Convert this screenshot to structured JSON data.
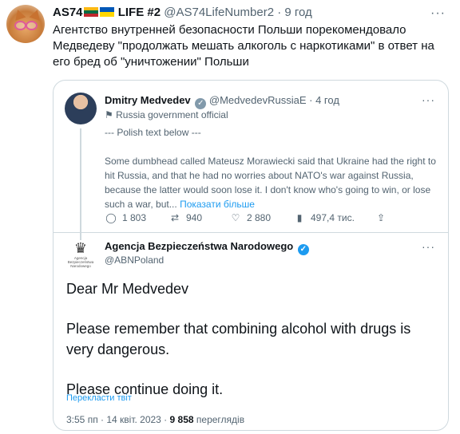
{
  "outer_tweet": {
    "author_name": "AS74",
    "author_suffix": "LIFE #2",
    "handle": "@AS74LifeNumber2",
    "separator": "·",
    "time": "9 год",
    "text": "Агентство внутренней безопасности Польши порекомендовало Медведеву \"продолжать мешать алкоголь с наркотиками\" в ответ на его бред об \"уничтожении\" Польши",
    "more_icon": "more-horizontal-icon"
  },
  "quoted_tweet": {
    "author_name": "Dmitry Medvedev",
    "handle": "@MedvedevRussiaE",
    "separator": "·",
    "time": "4 год",
    "gov_label": "Russia government official",
    "flag_icon": "government-flag-icon",
    "line1": "--- Polish text below ---",
    "body": "Some dumbhead called Mateusz Morawiecki said that Ukraine had the right to hit Russia, and that he had no worries about NATO's war against Russia, because the latter would soon lose it. I don't know who's going to win, or lose such a war, but...",
    "show_more": "Показати більше",
    "actions": {
      "replies": "1 803",
      "retweets": "940",
      "likes": "2 880",
      "views": "497,4 тис."
    }
  },
  "abn_tweet": {
    "author_name": "Agencja Bezpieczeństwa Narodowego",
    "handle": "@ABNPoland",
    "logo_text": "Agencja Bezpieczeństwa Narodowego",
    "greeting": "Dear Mr Medvedev",
    "line2": "Please remember that combining alcohol with drugs is very dangerous.",
    "line3": "Please continue doing it.",
    "translate": "Перекласти твіт",
    "timestamp": "3:55 пп · 14 квіт. 2023 ·",
    "views_count": "9 858",
    "views_label": "переглядів"
  },
  "colors": {
    "link": "#1d9bf0",
    "secondary_text": "#536471",
    "border": "#cfd9de"
  }
}
